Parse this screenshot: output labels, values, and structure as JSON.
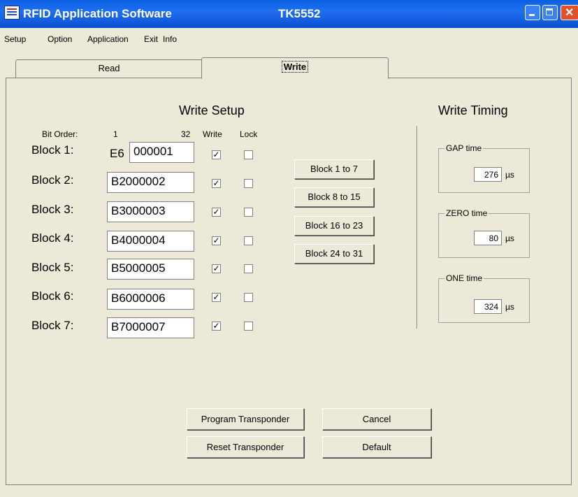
{
  "window": {
    "title": "RFID Application Software",
    "model": "TK5552"
  },
  "menu": [
    "Setup",
    "Option",
    "Application",
    "Exit",
    "Info"
  ],
  "tabs": [
    {
      "label": "Read",
      "active": false
    },
    {
      "label": "Write",
      "active": true
    }
  ],
  "write_setup": {
    "title": "Write Setup",
    "bit_order_label": "Bit Order:",
    "bit_start": "1",
    "bit_end": "32",
    "col_write": "Write",
    "col_lock": "Lock",
    "block1_prefix": "E6",
    "blocks": [
      {
        "label": "Block 1:",
        "value": "000001",
        "write": "✓",
        "lock": ""
      },
      {
        "label": "Block 2:",
        "value": "B2000002",
        "write": "✓",
        "lock": ""
      },
      {
        "label": "Block 3:",
        "value": "B3000003",
        "write": "✓",
        "lock": ""
      },
      {
        "label": "Block 4:",
        "value": "B4000004",
        "write": "✓",
        "lock": ""
      },
      {
        "label": "Block 5:",
        "value": "B5000005",
        "write": "✓",
        "lock": ""
      },
      {
        "label": "Block 6:",
        "value": "B6000006",
        "write": "✓",
        "lock": ""
      },
      {
        "label": "Block 7:",
        "value": "B7000007",
        "write": "✓",
        "lock": ""
      }
    ],
    "range_buttons": [
      "Block 1 to 7",
      "Block 8 to 15",
      "Block 16 to 23",
      "Block 24 to 31"
    ]
  },
  "write_timing": {
    "title": "Write Timing",
    "gap": {
      "label": "GAP time",
      "value": "276",
      "unit": "µs"
    },
    "zero": {
      "label": "ZERO time",
      "value": "80",
      "unit": "µs"
    },
    "one": {
      "label": "ONE time",
      "value": "324",
      "unit": "µs"
    }
  },
  "actions": {
    "program": "Program Transponder",
    "reset": "Reset Transponder",
    "cancel": "Cancel",
    "default": "Default"
  }
}
